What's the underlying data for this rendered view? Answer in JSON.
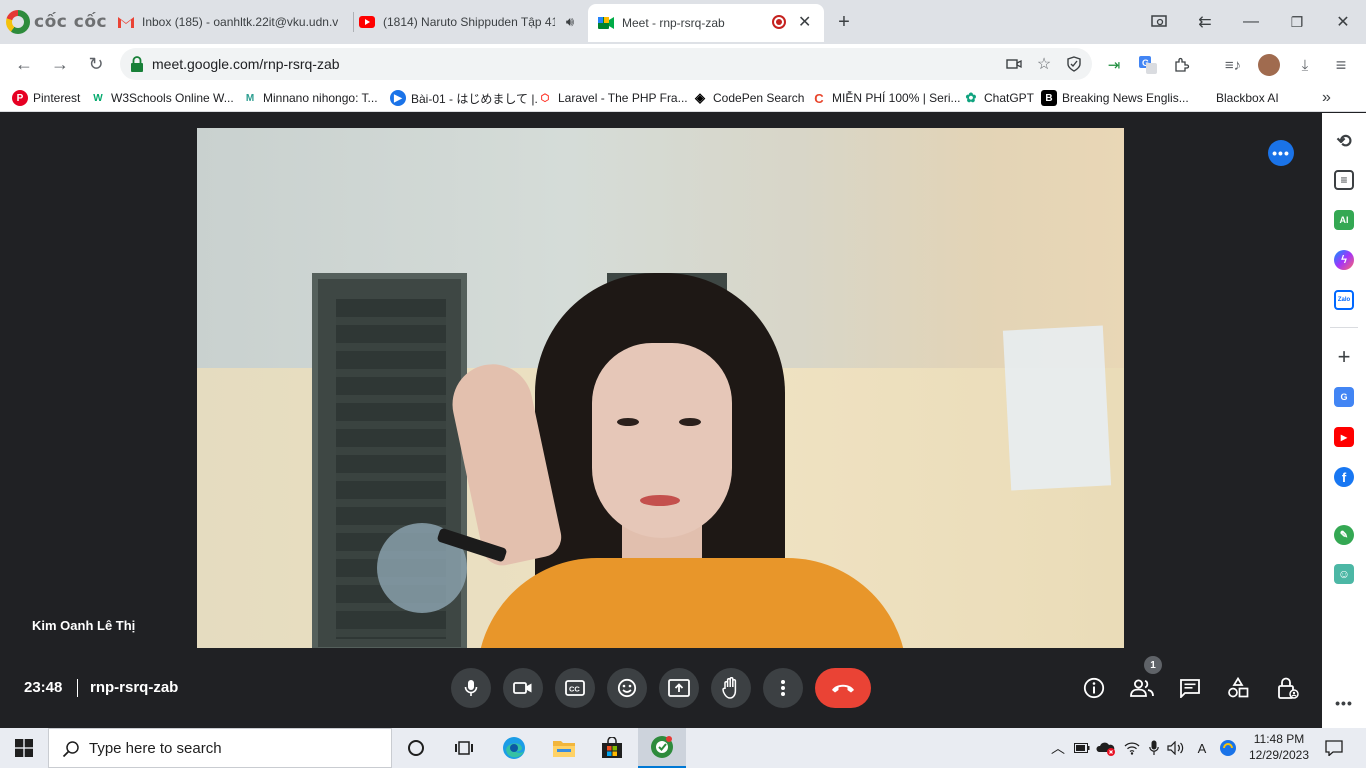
{
  "browser": {
    "logo_text": "cốc cốc",
    "tabs": [
      {
        "title": "Inbox (185) - oanhltk.22it@vku.udn.v",
        "icon": "gmail-icon"
      },
      {
        "title": "(1814) Naruto Shippuden Tập 41",
        "icon": "youtube-icon"
      },
      {
        "title": "Meet - rnp-rsrq-zab",
        "icon": "meet-icon",
        "active": true
      }
    ],
    "url": "meet.google.com/rnp-rsrq-zab",
    "bookmarks": [
      {
        "label": "Pinterest",
        "icon": "pinterest-icon",
        "color": "#e60023"
      },
      {
        "label": "W3Schools Online W...",
        "icon": "w3schools-icon",
        "color": "#04aa6d"
      },
      {
        "label": "Minnano nihongo: T...",
        "icon": "minnano-icon",
        "color": "#2a9d8f"
      },
      {
        "label": "Bài-01 - はじめまして |...",
        "icon": "video-icon",
        "color": "#1a73e8"
      },
      {
        "label": "Laravel - The PHP Fra...",
        "icon": "laravel-icon",
        "color": "#ff2d20"
      },
      {
        "label": "CodePen Search",
        "icon": "codepen-icon",
        "color": "#000000"
      },
      {
        "label": "MIỄN PHÍ 100% | Seri...",
        "icon": "c-icon",
        "color": "#e8452c"
      },
      {
        "label": "ChatGPT",
        "icon": "chatgpt-icon",
        "color": "#10a37f"
      },
      {
        "label": "Breaking News Englis...",
        "icon": "b-icon",
        "color": "#000000"
      },
      {
        "label": "Blackbox AI",
        "icon": "blackbox-icon",
        "color": "#000000"
      }
    ]
  },
  "meet": {
    "participant_name": "Kim Oanh Lê Thị",
    "time": "23:48",
    "meeting_code": "rnp-rsrq-zab",
    "people_count": "1",
    "colors": {
      "leave": "#ea4335",
      "control_bg": "#3c4043",
      "accent": "#1a73e8"
    }
  },
  "taskbar": {
    "search_placeholder": "Type here to search",
    "ime": "A",
    "clock_time": "11:48 PM",
    "clock_date": "12/29/2023"
  }
}
